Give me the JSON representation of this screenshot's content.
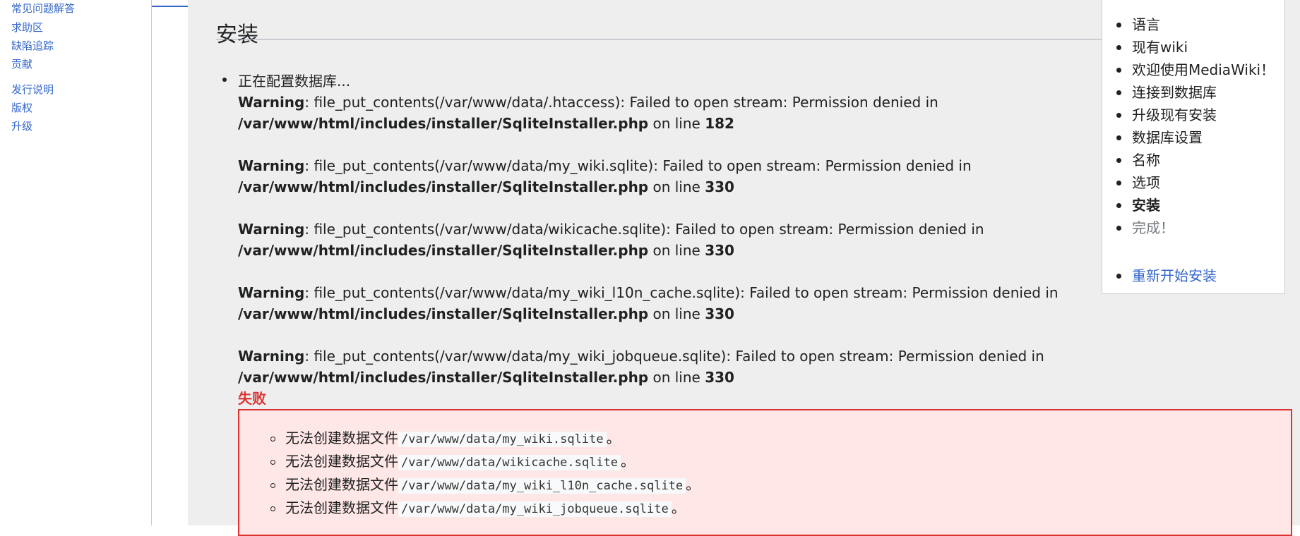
{
  "sidebar": {
    "links": [
      "常见问题解答",
      "求助区",
      "缺陷追踪",
      "贡献",
      "发行说明",
      "版权",
      "升级"
    ]
  },
  "main": {
    "title": "安装",
    "status": "正在配置数据库...",
    "warning_label": "Warning",
    "fail_path": "/var/www/html/includes/installer/SqliteInstaller.php",
    "on_line_text": "on line",
    "warnings": [
      {
        "msg": ": file_put_contents(/var/www/data/.htaccess): Failed to open stream: Permission denied in",
        "line": "182"
      },
      {
        "msg": ": file_put_contents(/var/www/data/my_wiki.sqlite): Failed to open stream: Permission denied in",
        "line": "330"
      },
      {
        "msg": ": file_put_contents(/var/www/data/wikicache.sqlite): Failed to open stream: Permission denied in",
        "line": "330"
      },
      {
        "msg": ": file_put_contents(/var/www/data/my_wiki_l10n_cache.sqlite): Failed to open stream: Permission denied in",
        "line": "330"
      },
      {
        "msg": ": file_put_contents(/var/www/data/my_wiki_jobqueue.sqlite): Failed to open stream: Permission denied in",
        "line": "330"
      }
    ],
    "fail_label": "失败",
    "error_prefix": "无法创建数据文件",
    "error_suffix": "。",
    "error_files": [
      "/var/www/data/my_wiki.sqlite",
      "/var/www/data/wikicache.sqlite",
      "/var/www/data/my_wiki_l10n_cache.sqlite",
      "/var/www/data/my_wiki_jobqueue.sqlite"
    ]
  },
  "toc": {
    "items": [
      "语言",
      "现有wiki",
      "欢迎使用MediaWiki！",
      "连接到数据库",
      "升级现有安装",
      "数据库设置",
      "名称",
      "选项",
      "安装",
      "完成！"
    ],
    "restart": "重新开始安装"
  }
}
